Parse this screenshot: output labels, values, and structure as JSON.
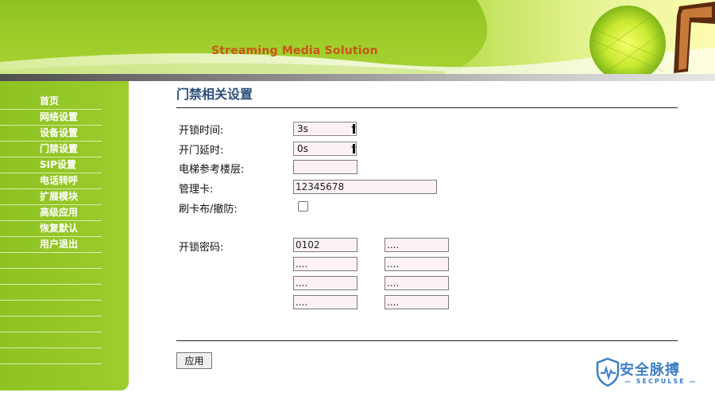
{
  "banner": {
    "title": "Streaming Media Solution"
  },
  "sidebar": {
    "items": [
      {
        "label": "首页"
      },
      {
        "label": "网络设置"
      },
      {
        "label": "设备设置"
      },
      {
        "label": "门禁设置"
      },
      {
        "label": "SIP设置"
      },
      {
        "label": "电话转呼"
      },
      {
        "label": "扩展模块"
      },
      {
        "label": "高级应用"
      },
      {
        "label": "恢复默认"
      },
      {
        "label": "用户退出"
      }
    ]
  },
  "main": {
    "title": "门禁相关设置",
    "fields": {
      "unlock_time": {
        "label": "开锁时间:",
        "value": "3s"
      },
      "door_delay": {
        "label": "开门延时:",
        "value": "0s"
      },
      "elevator_floor": {
        "label": "电梯参考楼层:",
        "value": ""
      },
      "admin_card": {
        "label": "管理卡:",
        "value": "12345678"
      },
      "card_arm": {
        "label": "刷卡布/撤防:",
        "checked": false
      },
      "unlock_password": {
        "label": "开锁密码:",
        "values": [
          "0102",
          "....",
          "....",
          "....",
          "....",
          "....",
          "....",
          "...."
        ]
      }
    },
    "apply_label": "应用"
  },
  "watermark": {
    "text": "安全脉搏",
    "subtext": "— SECPULSE —"
  },
  "colors": {
    "header_green": "#9ccc2a",
    "sidebar_green": "#8cc322",
    "title_orange": "#c9551a",
    "heading_blue": "#2b4f7a",
    "input_bg": "#fbf1f7"
  }
}
